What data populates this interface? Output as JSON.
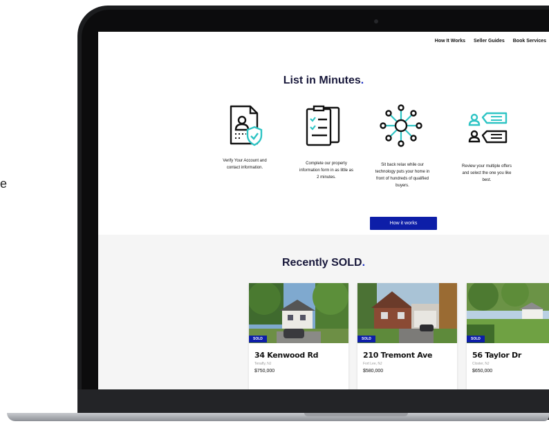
{
  "stray_text": "e",
  "nav": {
    "items": [
      "How It Works",
      "Seller Guides",
      "Book Services"
    ]
  },
  "hero": {
    "title": "List in Minutes",
    "title_dot": "."
  },
  "steps": [
    {
      "icon": "verify-account-icon",
      "text": "Verify Your Account and contact information."
    },
    {
      "icon": "property-form-icon",
      "text": "Complete our property information form in as little as 2 minutes."
    },
    {
      "icon": "buyer-network-icon",
      "text": "Sit back relax while our technology puts your home in front of hundreds of qualified buyers."
    },
    {
      "icon": "review-offers-icon",
      "text": "Review your multiple offers and select the one you like best."
    }
  ],
  "cta": {
    "label": "How it works"
  },
  "sold": {
    "title": "Recently SOLD",
    "title_dot": ".",
    "listings": [
      {
        "badge": "SOLD",
        "address": "34 Kenwood Rd",
        "city": "Tenafly, NJ",
        "price": "$750,000"
      },
      {
        "badge": "SOLD",
        "address": "210 Tremont Ave",
        "city": "Fort Lee, NJ",
        "price": "$580,000"
      },
      {
        "badge": "SOLD",
        "address": "56 Taylor Dr",
        "city": "Closter, NJ",
        "price": "$650,000"
      }
    ]
  },
  "colors": {
    "accent": "#0d1ea8",
    "icon_teal": "#2ec4c4",
    "heading": "#17173a"
  }
}
